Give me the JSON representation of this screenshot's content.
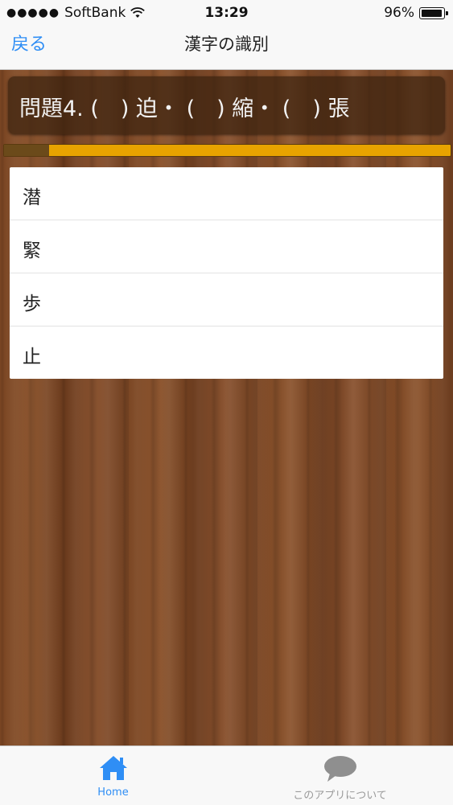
{
  "status_bar": {
    "carrier": "SoftBank",
    "time": "13:29",
    "battery": "96%",
    "battery_level": 0.96
  },
  "nav": {
    "back_label": "戻る",
    "title": "漢字の識別"
  },
  "question": {
    "text": "問題4. (　) 迫・ (　) 縮・ (　) 張"
  },
  "progress": {
    "fraction": 0.1
  },
  "answers": [
    {
      "label": "潜"
    },
    {
      "label": "緊"
    },
    {
      "label": "歩"
    },
    {
      "label": "止"
    }
  ],
  "tabs": [
    {
      "label": "Home",
      "icon": "home-icon"
    },
    {
      "label": "このアプリについて",
      "icon": "chat-bubble-icon"
    }
  ],
  "colors": {
    "accent": "#2f8ef5",
    "progress_fill": "#e8a300",
    "progress_done": "#6b4a1a"
  }
}
